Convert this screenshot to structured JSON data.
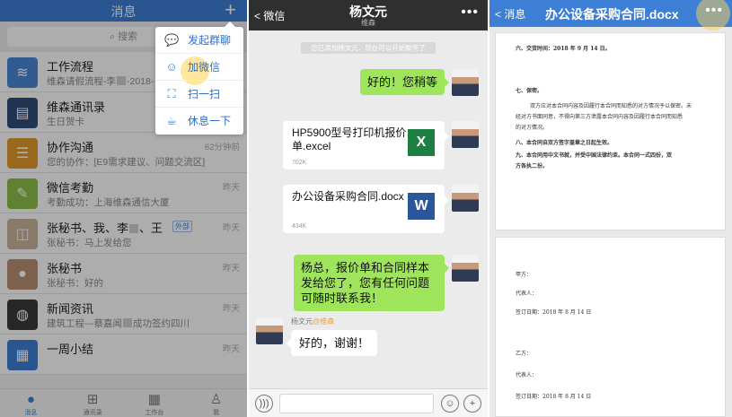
{
  "left": {
    "nav_title": "消息",
    "plus_label": "+",
    "search_placeholder": "搜索",
    "rows": [
      {
        "name": "工作流程",
        "sub": "维森请假流程-李",
        "sub2": "-2018-",
        "time": ""
      },
      {
        "name": "维森通讯录",
        "sub": "生日贺卡",
        "time": ""
      },
      {
        "name": "协作沟通",
        "sub": "您的协作：[E9需求建议、问题交流区]",
        "time": "62分钟前"
      },
      {
        "name": "微信考勤",
        "sub": "考勤成功：上海维森通信大厦",
        "time": "昨天"
      },
      {
        "name": "张秘书、我、李",
        "name2": "、王",
        "ext": "外部",
        "sub": "张秘书：马上发给您",
        "time": "昨天"
      },
      {
        "name": "张秘书",
        "sub": "张秘书：好的",
        "time": "昨天"
      },
      {
        "name": "新闻资讯",
        "sub": "建筑工程---蔡嘉闻",
        "sub2": "成功签约四川",
        "time": "昨天"
      },
      {
        "name": "一周小结",
        "sub": "",
        "time": "昨天"
      }
    ],
    "popup": [
      "发起群聊",
      "加微信",
      "扫一扫",
      "休息一下"
    ],
    "tabs": [
      "消息",
      "通讯录",
      "工作台",
      "我"
    ]
  },
  "chat": {
    "back": "微信",
    "title": "杨文元",
    "subtitle": "维森",
    "more": "•••",
    "system_tip": "您已添加杨文元，现在可以开始聊天了",
    "msg1": "好的！您稍等",
    "file1": {
      "name": "HP5900型号打印机报价单.excel",
      "size": "702K",
      "icon": "X"
    },
    "file2": {
      "name": "办公设备采购合同.docx",
      "size": "434K",
      "icon": "W"
    },
    "msg2": "杨总，报价单和合同样本发给您了，您有任何问题可随时联系我！",
    "other_name": "杨文元",
    "other_org": "@维森",
    "msg3": "好的，谢谢！"
  },
  "doc": {
    "back": "消息",
    "title": "办公设备采购合同.docx",
    "more": "•••",
    "page1": {
      "l1": "六、交货时间：2018 年 9 月 14 日。",
      "l2": "七、保密。",
      "l3": "双方应对本合同内容及因履行本合同而知悉的对方情况予以保密。未",
      "l4": "经对方书面同意，不得向第三方泄露本合同内容及因履行本合同而知悉",
      "l5": "的对方情况。",
      "l6": "八、本合同自双方签字盖章之日起生效。",
      "l7": "九、本合同用中文书就，并受中国法律约束。本合同一式四份，双",
      "l8": "方各执二份。"
    },
    "page2": {
      "a1": "甲方：",
      "a2": "代表人：",
      "a3": "签订日期：2018 年 8 月 14 日",
      "b1": "乙方：",
      "b2": "代表人：",
      "b3": "签订日期：2018 年 8 月 14 日"
    }
  },
  "colors": {
    "accent": "#3d7fd4",
    "chat_nav": "#2f2f2f",
    "bubble_green": "#9ee55b"
  }
}
